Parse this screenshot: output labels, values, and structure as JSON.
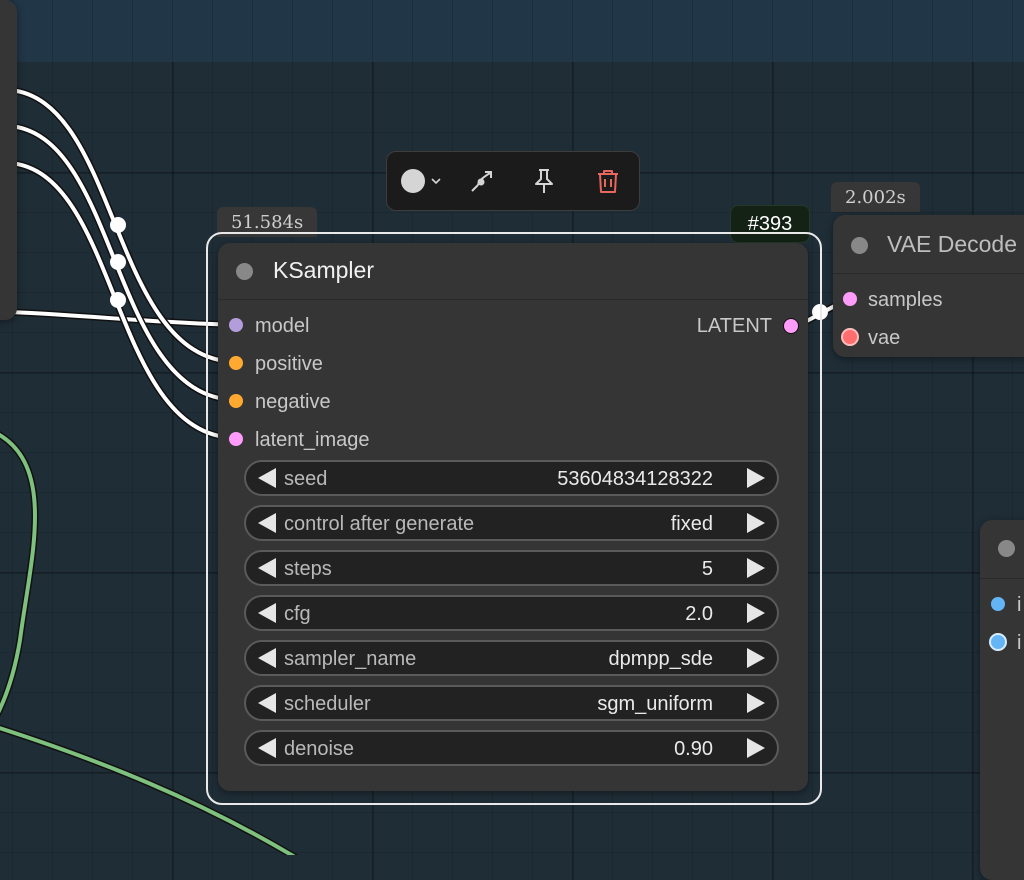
{
  "toolbar": {
    "items": [
      {
        "icon": "color-circle-icon",
        "extra": "chevron-down-icon"
      },
      {
        "icon": "bypass-icon"
      },
      {
        "icon": "pin-icon"
      },
      {
        "icon": "trash-icon"
      }
    ],
    "colors": {
      "icon": "#d5d5d5",
      "trash": "#e5675e"
    }
  },
  "ksampler": {
    "time": "51.584s",
    "id": "#393",
    "title": "KSampler",
    "inputs": [
      {
        "label": "model",
        "color": "#b39ddb"
      },
      {
        "label": "positive",
        "color": "#ffa931"
      },
      {
        "label": "negative",
        "color": "#ffa931"
      },
      {
        "label": "latent_image",
        "color": "#ff9cf9"
      }
    ],
    "output": {
      "label": "LATENT",
      "color": "#ff9cf9"
    },
    "widgets": [
      {
        "name": "seed",
        "value": "53604834128322"
      },
      {
        "name": "control after generate",
        "value": "fixed"
      },
      {
        "name": "steps",
        "value": "5"
      },
      {
        "name": "cfg",
        "value": "2.0"
      },
      {
        "name": "sampler_name",
        "value": "dpmpp_sde"
      },
      {
        "name": "scheduler",
        "value": "sgm_uniform"
      },
      {
        "name": "denoise",
        "value": "0.90"
      }
    ]
  },
  "vae_decode": {
    "time": "2.002s",
    "title": "VAE Decode",
    "inputs": [
      {
        "label": "samples",
        "color": "#ff9cf9"
      },
      {
        "label": "vae",
        "color": "#ff6e6e"
      }
    ]
  },
  "right_node": {
    "inputs": [
      {
        "label": "i",
        "color": "#64b5f6"
      },
      {
        "label": "i",
        "color": "#64b5f6"
      }
    ]
  },
  "wire_colors": {
    "link": "#ffffff",
    "green": "#7ec07e"
  }
}
